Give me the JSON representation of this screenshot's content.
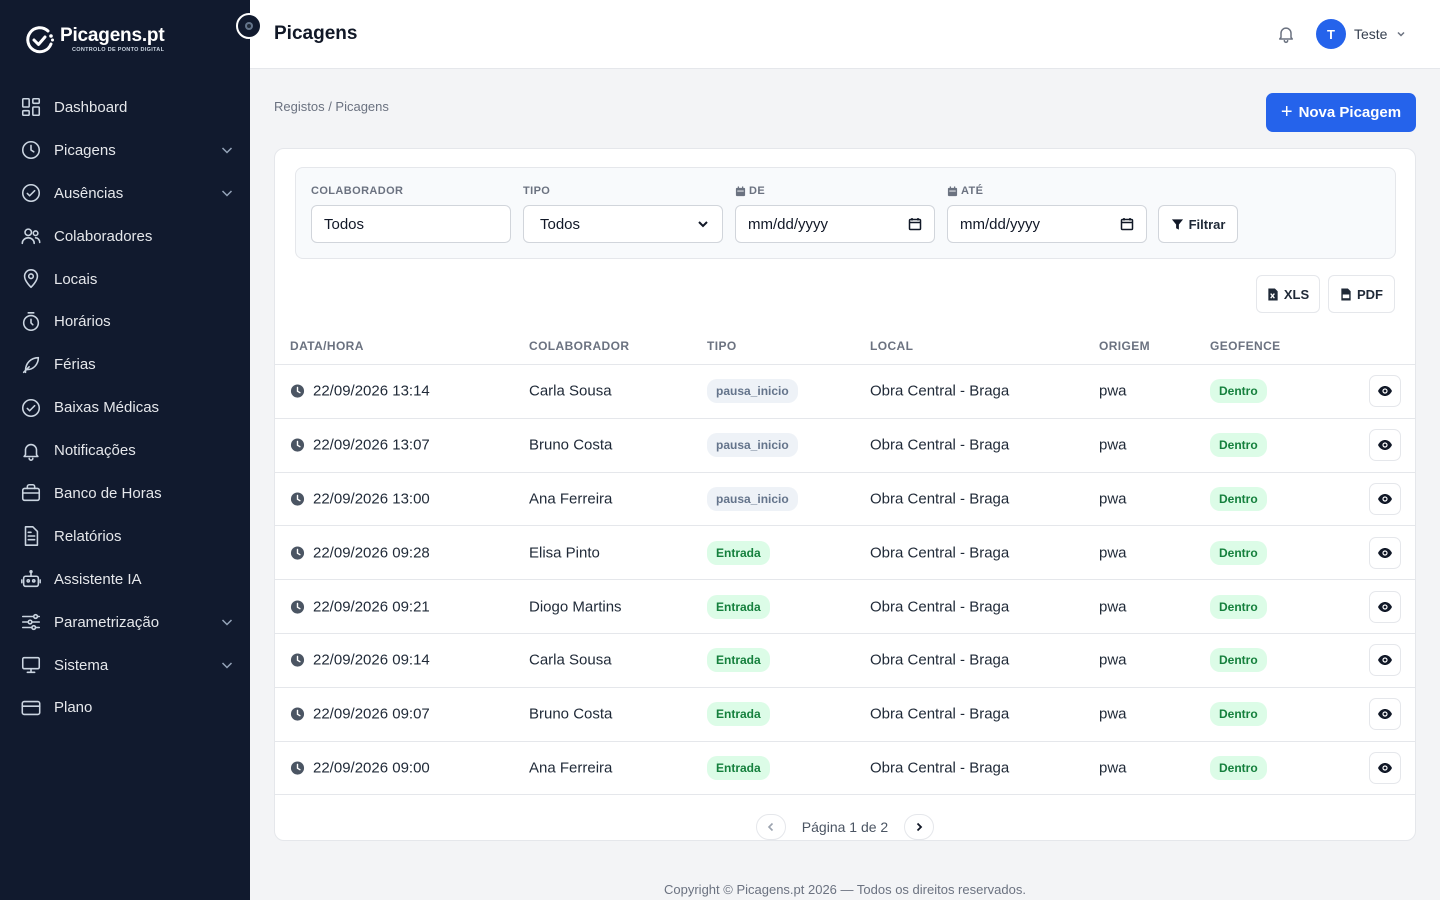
{
  "brand": {
    "title": "Picagens.pt",
    "subtitle": "CONTROLO DE PONTO DIGITAL"
  },
  "sidebar": {
    "items": [
      {
        "label": "Dashboard",
        "icon": "dashboard-icon",
        "expandable": false
      },
      {
        "label": "Picagens",
        "icon": "clock-icon",
        "expandable": true
      },
      {
        "label": "Ausências",
        "icon": "check-circle-icon",
        "expandable": true
      },
      {
        "label": "Colaboradores",
        "icon": "users-icon",
        "expandable": false
      },
      {
        "label": "Locais",
        "icon": "map-pin-icon",
        "expandable": false
      },
      {
        "label": "Horários",
        "icon": "timer-icon",
        "expandable": false
      },
      {
        "label": "Férias",
        "icon": "feather-icon",
        "expandable": false
      },
      {
        "label": "Baixas Médicas",
        "icon": "check-circle-icon",
        "expandable": false
      },
      {
        "label": "Notificações",
        "icon": "bell-icon",
        "expandable": false
      },
      {
        "label": "Banco de Horas",
        "icon": "briefcase-icon",
        "expandable": false
      },
      {
        "label": "Relatórios",
        "icon": "file-text-icon",
        "expandable": false
      },
      {
        "label": "Assistente IA",
        "icon": "robot-icon",
        "expandable": false
      },
      {
        "label": "Parametrização",
        "icon": "sliders-icon",
        "expandable": true
      },
      {
        "label": "Sistema",
        "icon": "monitor-icon",
        "expandable": true
      },
      {
        "label": "Plano",
        "icon": "credit-card-icon",
        "expandable": false
      }
    ]
  },
  "topbar": {
    "title": "Picagens",
    "user_initial": "T",
    "user_name": "Teste"
  },
  "breadcrumb": "Registos / Picagens",
  "actions": {
    "new_label": "Nova Picagem",
    "new_icon": "+"
  },
  "filters": {
    "colaborador_label": "COLABORADOR",
    "colaborador_value": "Todos",
    "tipo_label": "TIPO",
    "tipo_value": "Todos",
    "de_label": "DE",
    "de_value": "mm/dd/yyyy",
    "ate_label": "ATÉ",
    "ate_value": "mm/dd/yyyy",
    "filter_button": "Filtrar"
  },
  "export": {
    "xls": "XLS",
    "pdf": "PDF"
  },
  "table": {
    "headers": [
      "DATA/HORA",
      "COLABORADOR",
      "TIPO",
      "LOCAL",
      "ORIGEM",
      "GEOFENCE"
    ],
    "rows": [
      {
        "datetime": "22/09/2026 13:14",
        "colaborador": "Carla Sousa",
        "tipo": "pausa_inicio",
        "tipo_style": "gray",
        "local": "Obra Central - Braga",
        "origem": "pwa",
        "geofence": "Dentro"
      },
      {
        "datetime": "22/09/2026 13:07",
        "colaborador": "Bruno Costa",
        "tipo": "pausa_inicio",
        "tipo_style": "gray",
        "local": "Obra Central - Braga",
        "origem": "pwa",
        "geofence": "Dentro"
      },
      {
        "datetime": "22/09/2026 13:00",
        "colaborador": "Ana Ferreira",
        "tipo": "pausa_inicio",
        "tipo_style": "gray",
        "local": "Obra Central - Braga",
        "origem": "pwa",
        "geofence": "Dentro"
      },
      {
        "datetime": "22/09/2026 09:28",
        "colaborador": "Elisa Pinto",
        "tipo": "Entrada",
        "tipo_style": "green",
        "local": "Obra Central - Braga",
        "origem": "pwa",
        "geofence": "Dentro"
      },
      {
        "datetime": "22/09/2026 09:21",
        "colaborador": "Diogo Martins",
        "tipo": "Entrada",
        "tipo_style": "green",
        "local": "Obra Central - Braga",
        "origem": "pwa",
        "geofence": "Dentro"
      },
      {
        "datetime": "22/09/2026 09:14",
        "colaborador": "Carla Sousa",
        "tipo": "Entrada",
        "tipo_style": "green",
        "local": "Obra Central - Braga",
        "origem": "pwa",
        "geofence": "Dentro"
      },
      {
        "datetime": "22/09/2026 09:07",
        "colaborador": "Bruno Costa",
        "tipo": "Entrada",
        "tipo_style": "green",
        "local": "Obra Central - Braga",
        "origem": "pwa",
        "geofence": "Dentro"
      },
      {
        "datetime": "22/09/2026 09:00",
        "colaborador": "Ana Ferreira",
        "tipo": "Entrada",
        "tipo_style": "green",
        "local": "Obra Central - Braga",
        "origem": "pwa",
        "geofence": "Dentro"
      }
    ]
  },
  "pagination": {
    "text": "Página 1 de 2"
  },
  "footer": "Copyright © Picagens.pt 2026 — Todos os direitos reservados.",
  "colors": {
    "sidebar_bg": "#111a2e",
    "accent": "#2563eb",
    "badge_green_bg": "#dcfce7",
    "badge_green_text": "#15803d",
    "badge_gray_bg": "#eef2f7",
    "badge_gray_text": "#64748b"
  }
}
